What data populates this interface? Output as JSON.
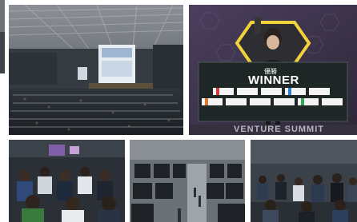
{
  "gallery": {
    "photos": [
      {
        "name": "auditorium-wide-shot"
      },
      {
        "name": "winner-stage-photo"
      },
      {
        "name": "audience-closeup"
      },
      {
        "name": "exhibition-booths"
      },
      {
        "name": "networking-crowd"
      }
    ]
  },
  "winner_photo": {
    "kanji_label": "優勝",
    "title": "WINNER",
    "event_name": "VENTURE SUMMIT",
    "sponsor_logo_count": 15
  },
  "colors": {
    "stage_purple": "#3a2f4a",
    "winner_board": "#1f2626",
    "accent_yellow": "#f2d23a",
    "venue_dark": "#2b3036"
  }
}
